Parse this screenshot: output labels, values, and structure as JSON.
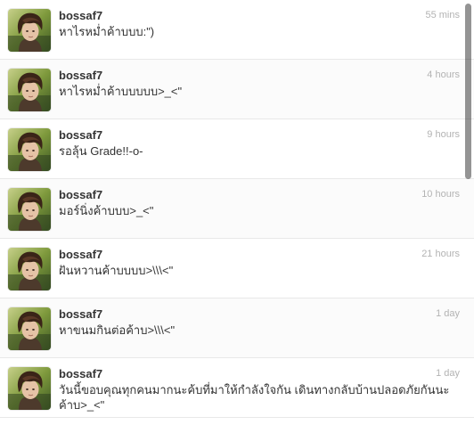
{
  "tweets": [
    {
      "username": "bossaf7",
      "time": "55 mins",
      "text": "หาไรหม่ำค้าบบบ:\")"
    },
    {
      "username": "bossaf7",
      "time": "4 hours",
      "text": "หาไรหม่ำค้าบบบบบ>_<\""
    },
    {
      "username": "bossaf7",
      "time": "9 hours",
      "text": "รอลุ้น Grade!!-o-"
    },
    {
      "username": "bossaf7",
      "time": "10 hours",
      "text": "มอร์นิ่งค้าบบบ>_<\""
    },
    {
      "username": "bossaf7",
      "time": "21 hours",
      "text": "ฝันหวานค้าบบบบ>\\\\\\<\""
    },
    {
      "username": "bossaf7",
      "time": "1 day",
      "text": "หาขนมกินต่อค้าบ>\\\\\\<\""
    },
    {
      "username": "bossaf7",
      "time": "1 day",
      "text": "วันนี้ขอบคุณทุกคนมากนะค้บที่มาให้กำลังใจกัน เดินทางกลับบ้านปลอดภัยกันนะค้าบ>_<\""
    }
  ],
  "colors": {
    "username": "#333333",
    "timestamp": "#b3b3b3",
    "divider": "#e8e8e8"
  },
  "icons": {
    "avatar": "profile-photo"
  },
  "scroll": {
    "position": 0.0
  }
}
